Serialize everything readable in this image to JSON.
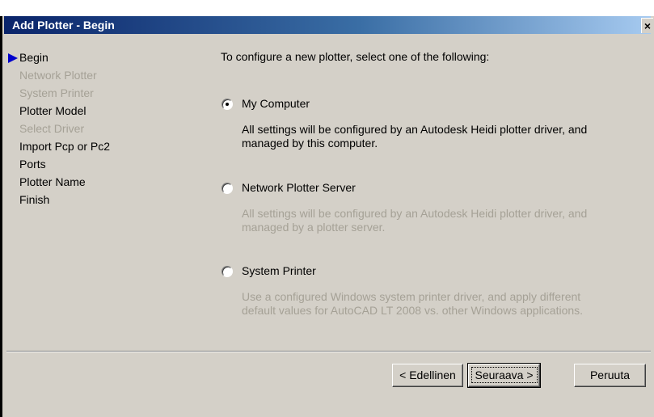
{
  "window": {
    "title": "Add Plotter - Begin",
    "close_glyph": "×",
    "colors": {
      "titlebar_start": "#0a246a",
      "titlebar_end": "#a6caf0",
      "face": "#d4d0c8",
      "disabled_text": "#a5a196"
    }
  },
  "steps": [
    {
      "label": "Begin",
      "state": "current"
    },
    {
      "label": "Network Plotter",
      "state": "disabled"
    },
    {
      "label": "System Printer",
      "state": "disabled"
    },
    {
      "label": "Plotter Model",
      "state": "enabled"
    },
    {
      "label": "Select Driver",
      "state": "disabled"
    },
    {
      "label": "Import Pcp or Pc2",
      "state": "enabled"
    },
    {
      "label": "Ports",
      "state": "enabled"
    },
    {
      "label": "Plotter Name",
      "state": "enabled"
    },
    {
      "label": "Finish",
      "state": "enabled"
    }
  ],
  "main": {
    "instruction": "To configure a new plotter, select one of the following:",
    "options": [
      {
        "label": "My Computer",
        "selected": true,
        "description": "All settings will be configured by an Autodesk Heidi plotter driver, and managed by this computer."
      },
      {
        "label": "Network Plotter Server",
        "selected": false,
        "description": "All settings will be configured by an Autodesk Heidi plotter driver, and managed by a plotter server."
      },
      {
        "label": "System Printer",
        "selected": false,
        "description": "Use a configured Windows system printer driver, and apply different default values for AutoCAD LT 2008 vs. other Windows applications."
      }
    ]
  },
  "buttons": {
    "back_label": "< Edellinen",
    "next_label": "Seuraava >",
    "cancel_label": "Peruuta"
  }
}
